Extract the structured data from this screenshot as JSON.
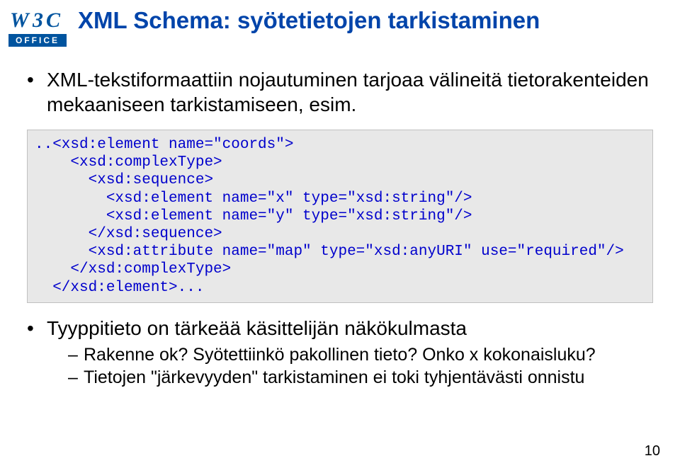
{
  "logo": {
    "top_text": "W3C",
    "bottom_text": "OFFICE"
  },
  "slide": {
    "title": "XML Schema: syötetietojen tarkistaminen",
    "bullets": [
      {
        "text": "XML-tekstiformaattiin nojautuminen tarjoaa välineitä tietorakenteiden mekaaniseen tarkistamiseen, esim."
      }
    ],
    "code": "..<xsd:element name=\"coords\">\n    <xsd:complexType>\n      <xsd:sequence>\n        <xsd:element name=\"x\" type=\"xsd:string\"/>\n        <xsd:element name=\"y\" type=\"xsd:string\"/>\n      </xsd:sequence>\n      <xsd:attribute name=\"map\" type=\"xsd:anyURI\" use=\"required\"/>\n    </xsd:complexType>\n  </xsd:element>...",
    "bullets2": [
      {
        "text": "Tyyppitieto on tärkeää käsittelijän näkökulmasta",
        "sub": [
          "Rakenne ok? Syötettiinkö pakollinen tieto? Onko x kokonaisluku?",
          "Tietojen \"järkevyyden\" tarkistaminen ei toki tyhjentävästi onnistu"
        ]
      }
    ],
    "pagenum": "10"
  }
}
